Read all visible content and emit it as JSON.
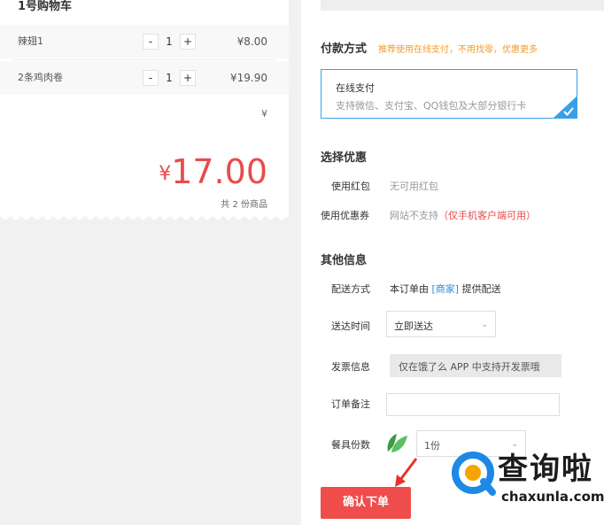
{
  "cart": {
    "title": "1号购物车",
    "items": [
      {
        "name": "辣翅1",
        "minus": "-",
        "qty": "1",
        "plus": "+",
        "price": "¥8.00"
      },
      {
        "name": "2条鸡肉卷",
        "minus": "-",
        "qty": "1",
        "plus": "+",
        "price": "¥19.90"
      }
    ],
    "fee_symbol": "¥",
    "total_symbol": "¥",
    "total_amount": "17.00",
    "count_text": "共 2 份商品"
  },
  "payment": {
    "title": "付款方式",
    "hint": "推荐使用在线支付，不用找零，优惠更多",
    "option_name": "在线支付",
    "option_desc": "支持微信、支付宝、QQ钱包及大部分银行卡",
    "colors": {
      "border": "#3aa0e6",
      "hint": "#f29b2c"
    }
  },
  "discount": {
    "title": "选择优惠",
    "red_packet_label": "使用红包",
    "red_packet_value": "无可用红包",
    "coupon_label": "使用优惠券",
    "coupon_value": "网站不支持",
    "coupon_note": "（仅手机客户端可用）"
  },
  "other": {
    "title": "其他信息",
    "delivery_label": "配送方式",
    "delivery_prefix": "本订单由",
    "delivery_link": "[商家]",
    "delivery_suffix": "提供配送",
    "time_label": "送达时间",
    "time_value": "立即送达",
    "invoice_label": "发票信息",
    "invoice_value": "仅在饿了么 APP 中支持开发票哦",
    "remark_label": "订单备注",
    "remark_value": "",
    "tableware_label": "餐具份数",
    "tableware_value": "1份"
  },
  "confirm_label": "确认下单",
  "watermark": {
    "cn": "查询啦",
    "en": "chaxunla.com"
  },
  "colors": {
    "accent_red": "#e84b4b",
    "button_red": "#ef4c4c",
    "link_blue": "#2d8cd8",
    "leaf_green": "#4caf50"
  }
}
